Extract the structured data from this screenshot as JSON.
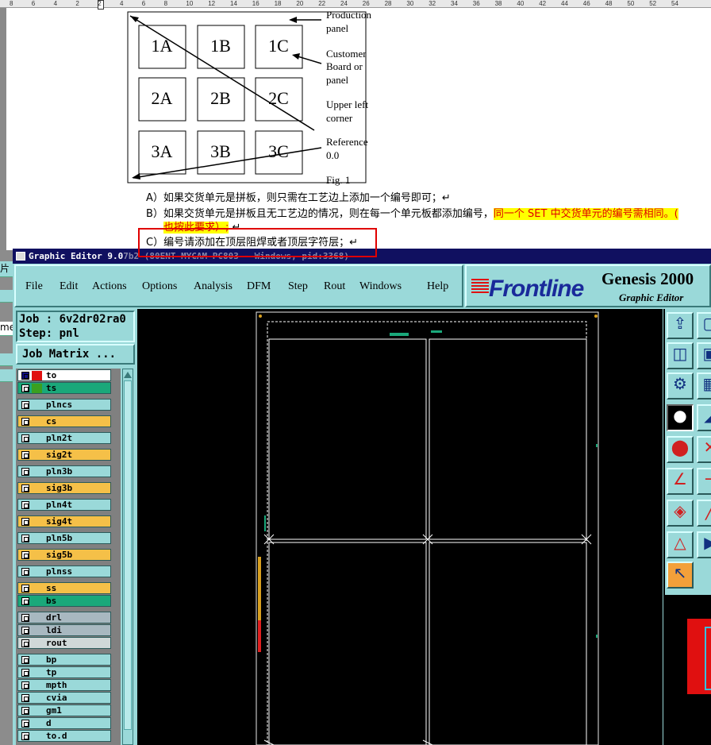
{
  "ruler": {
    "labels": [
      "8",
      "6",
      "4",
      "2",
      "2",
      "4",
      "6",
      "8",
      "10",
      "12",
      "14",
      "16",
      "18",
      "20",
      "22",
      "24",
      "26",
      "28",
      "30",
      "32",
      "34",
      "36",
      "38",
      "40",
      "42",
      "44",
      "46",
      "48",
      "50",
      "52",
      "54"
    ]
  },
  "doc": {
    "figure": {
      "cells": [
        "1A",
        "1B",
        "1C",
        "2A",
        "2B",
        "2C",
        "3A",
        "3B",
        "3C"
      ],
      "labels": {
        "production": "Production",
        "panel": "panel",
        "customer": "Customer",
        "board_or": "Board or",
        "panel2": "panel",
        "upper_left": "Upper left",
        "corner": "corner",
        "reference": "Reference",
        "ref_value": "0.0"
      },
      "caption": "Fig. 1"
    },
    "line_a": "A）如果交货单元是拼板，则只需在工艺边上添加一个编号即可；↵",
    "line_b_plain": "B）如果交货单元是拼板且无工艺边的情况，则在每一个单元板都添加编号，",
    "line_b_highlight": "同一个 SET 中交货单元的编号需相同。(",
    "line_b2_highlight": "也按此要求）;",
    "line_b2_tail": " ↵",
    "line_c": "C）编号请添加在顶层阻焊或者顶层字符层；↵"
  },
  "behind_window": {
    "labels": [
      "片",
      "me"
    ]
  },
  "app": {
    "title": "Graphic Editor 9.0",
    "title_ghost": "7b2 (80ENT-MYCAM PC803 - Windows, pid:3368)",
    "menu": [
      "File",
      "Edit",
      "Actions",
      "Options",
      "Analysis",
      "DFM",
      "Step",
      "Rout",
      "Windows",
      "Help"
    ],
    "logo": {
      "brand": "Frontline",
      "product": "Genesis 2000",
      "subtitle": "Graphic Editor"
    },
    "job_label": "Job : 6v2dr02ra0",
    "step_label": "Step: pnl",
    "job_matrix_button": "Job Matrix ...",
    "layers": [
      {
        "name": "to",
        "color": "#ffffff"
      },
      {
        "name": "ts",
        "color": "#1aa87a"
      },
      {
        "name": "plncs",
        "color": "#9ad9d9"
      },
      {
        "name": "cs",
        "color": "#f5c048"
      },
      {
        "name": "pln2t",
        "color": "#9ad9d9"
      },
      {
        "name": "sig2t",
        "color": "#f5c048"
      },
      {
        "name": "pln3b",
        "color": "#9ad9d9"
      },
      {
        "name": "sig3b",
        "color": "#f5c048"
      },
      {
        "name": "pln4t",
        "color": "#9ad9d9"
      },
      {
        "name": "sig4t",
        "color": "#f5c048"
      },
      {
        "name": "pln5b",
        "color": "#9ad9d9"
      },
      {
        "name": "sig5b",
        "color": "#f5c048"
      },
      {
        "name": "plnss",
        "color": "#9ad9d9"
      },
      {
        "name": "ss",
        "color": "#f5c048"
      },
      {
        "name": "bs",
        "color": "#1aa87a"
      },
      {
        "name": "drl",
        "color": "#a8b8c0"
      },
      {
        "name": "ldi",
        "color": "#a8b8c0"
      },
      {
        "name": "rout",
        "color": "#d0d8d8"
      },
      {
        "name": "bp",
        "color": "#9ad9d9"
      },
      {
        "name": "tp",
        "color": "#9ad9d9"
      },
      {
        "name": "mpth",
        "color": "#9ad9d9"
      },
      {
        "name": "cvia",
        "color": "#9ad9d9"
      },
      {
        "name": "gm1",
        "color": "#9ad9d9"
      },
      {
        "name": "d",
        "color": "#9ad9d9"
      },
      {
        "name": "to.d",
        "color": "#9ad9d9"
      }
    ],
    "colors": {
      "accent": "#9ad9d9",
      "titlebar": "#101060",
      "highlight_box": "#e00000"
    },
    "tool_icons": [
      "open-job-icon",
      "zoom-home-icon",
      "move-icon",
      "toggle-icon",
      "tools-icon",
      "grid-icon",
      "snap-icon",
      "pan-icon",
      "select-icon",
      "cut-icon",
      "measure-icon",
      "line-icon",
      "transform-icon",
      "feature-icon",
      "pick-icon",
      "pointer-icon",
      "play-icon"
    ]
  }
}
